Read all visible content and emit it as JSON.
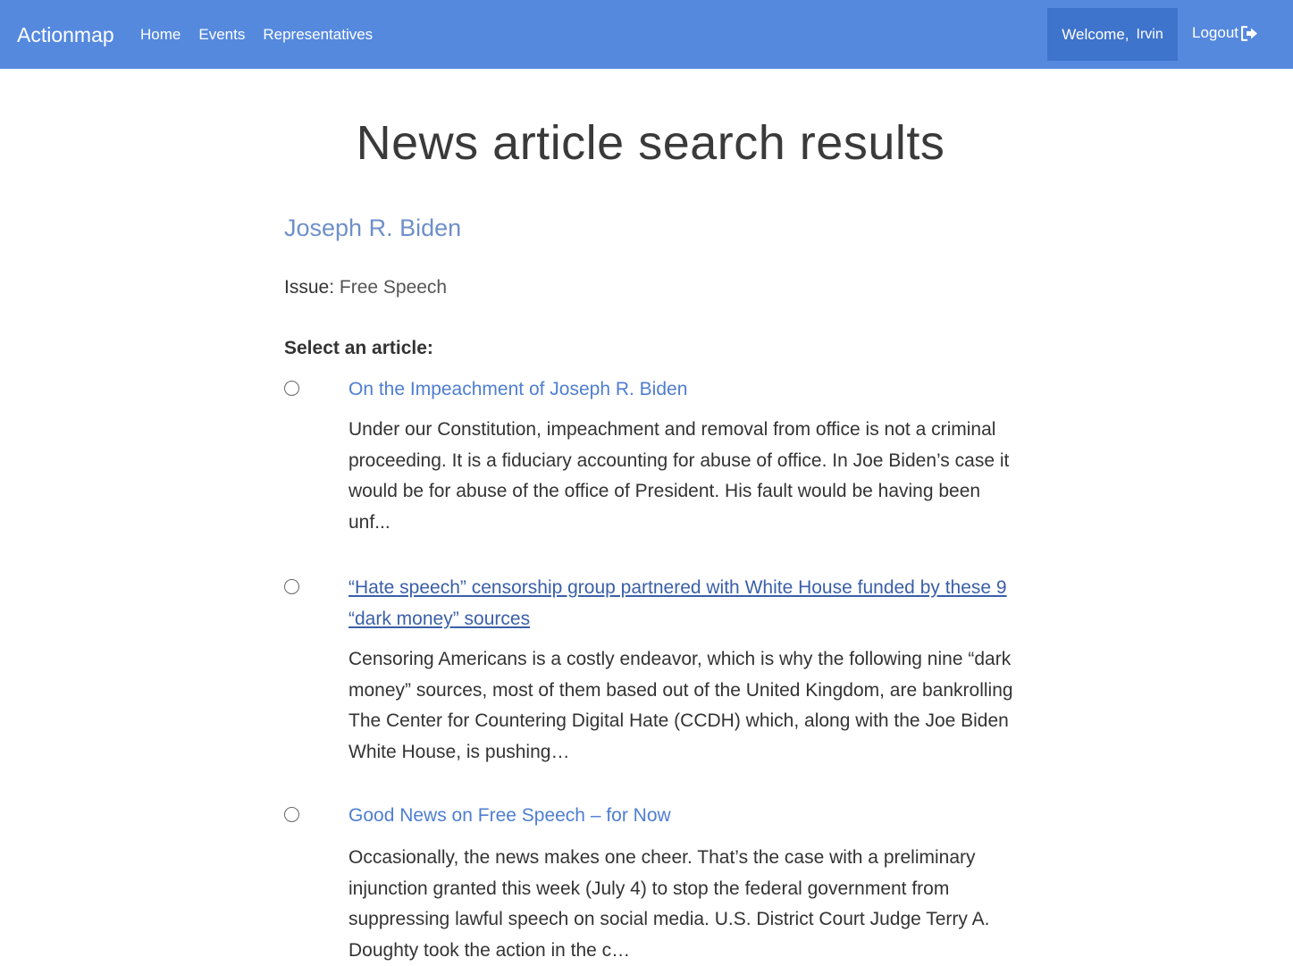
{
  "navbar": {
    "brand": "Actionmap",
    "links": [
      "Home",
      "Events",
      "Representatives"
    ],
    "welcome_label": "Welcome,",
    "username": "Irvin",
    "logout_label": "Logout",
    "color": "#5589de"
  },
  "page": {
    "title": "News article search results",
    "representative": "Joseph R. Biden",
    "issue_label": "Issue:",
    "issue_value": "Free Speech",
    "select_label": "Select an article:"
  },
  "articles": [
    {
      "title": "On the Impeachment of Joseph R. Biden",
      "summary": "Under our Constitution, impeachment and removal from office is not a criminal proceeding. It is a fiduciary accounting for abuse of office. In Joe Biden’s case it would be for abuse of the office of President. His fault would be having been unf..."
    },
    {
      "title": "“Hate speech” censorship group partnered with White House funded by these 9 “dark money” sources",
      "summary": "Censoring Americans is a costly endeavor, which is why the following nine “dark money” sources, most of them based out of the United Kingdom, are bankrolling The Center for Countering Digital Hate (CCDH) which, along with the Joe Biden White House, is pushing…"
    },
    {
      "title": "Good News on Free Speech – for Now",
      "summary": "Occasionally, the news makes one cheer. That’s the case with a preliminary injunction granted this week (July 4) to stop the federal government from suppressing lawful speech on social media. U.S. District Court Judge Terry A. Doughty took the action in the c…"
    }
  ]
}
